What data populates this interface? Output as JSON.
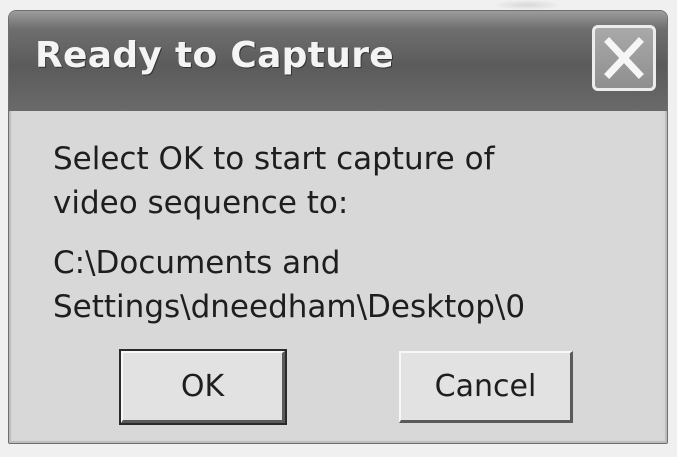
{
  "dialog": {
    "title": "Ready to Capture",
    "close_icon": "close-x-icon",
    "message_lines": [
      "Select OK to start capture of",
      "video sequence to:"
    ],
    "path_lines": [
      "C:\\Documents and",
      "Settings\\dneedham\\Desktop\\0"
    ],
    "buttons": {
      "ok": "OK",
      "cancel": "Cancel"
    }
  }
}
